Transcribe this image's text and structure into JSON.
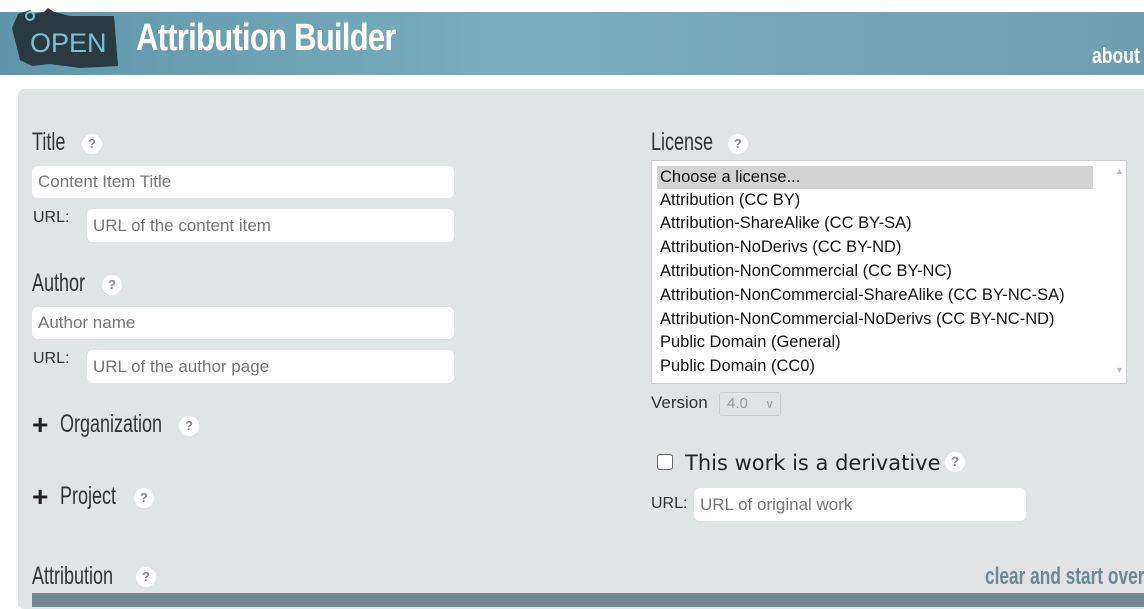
{
  "header": {
    "logo_text": "OPEN",
    "title": "Attribution Builder",
    "about_label": "about"
  },
  "title_section": {
    "label": "Title",
    "help": "?",
    "input_placeholder": "Content Item Title",
    "url_label": "URL:",
    "url_placeholder": "URL of the content item"
  },
  "author_section": {
    "label": "Author",
    "help": "?",
    "input_placeholder": "Author name",
    "url_label": "URL:",
    "url_placeholder": "URL of the author page"
  },
  "organization": {
    "expander": "+",
    "label": "Organization",
    "help": "?"
  },
  "project": {
    "expander": "+",
    "label": "Project",
    "help": "?"
  },
  "attribution": {
    "label": "Attribution",
    "help": "?",
    "clear_label": "clear and start over"
  },
  "license": {
    "label": "License",
    "help": "?",
    "options": [
      "Choose a license...",
      "Attribution (CC BY)",
      "Attribution-ShareAlike (CC BY-SA)",
      "Attribution-NoDerivs (CC BY-ND)",
      "Attribution-NonCommercial (CC BY-NC)",
      "Attribution-NonCommercial-ShareAlike (CC BY-NC-SA)",
      "Attribution-NonCommercial-NoDerivs (CC BY-NC-ND)",
      "Public Domain (General)",
      "Public Domain (CC0)"
    ],
    "selected": "Choose a license...",
    "version_label": "Version",
    "version_value": "4.0"
  },
  "derivative": {
    "checkbox_label": "This work is a derivative",
    "help": "?",
    "checked": false,
    "url_label": "URL:",
    "url_placeholder": "URL of original work"
  },
  "colors": {
    "header_bar": "#6f9eb0",
    "panel_bg": "#e1e4e5",
    "accent": "#6c8891"
  },
  "icons": {
    "logo": "washington-state-open-logo",
    "help": "question-circle-icon",
    "expand": "plus-icon",
    "dropdown": "chevron-down-icon"
  }
}
